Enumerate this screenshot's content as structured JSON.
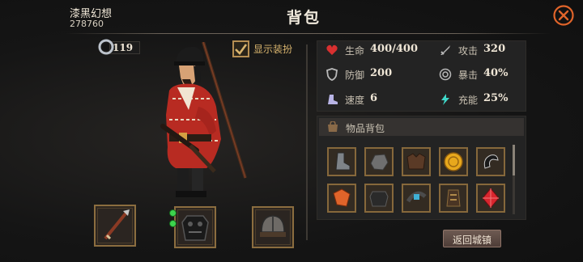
{
  "header": {
    "player_name": "漆黑幻想",
    "player_id": "278760",
    "title": "背包"
  },
  "currency": {
    "icon": "silver-ring-icon",
    "value": "119"
  },
  "display_toggle": {
    "label": "显示装扮",
    "checked": true
  },
  "equipment": [
    {
      "name": "weapon-slot",
      "icon": "spear-icon"
    },
    {
      "name": "armor-slot",
      "icon": "black-armor-icon",
      "indicator": "green-dots"
    },
    {
      "name": "helmet-slot",
      "icon": "helmet-icon"
    }
  ],
  "stats": {
    "hp_label": "生命",
    "hp_value": "400/400",
    "attack_label": "攻击",
    "attack_value": "320",
    "defense_label": "防御",
    "defense_value": "200",
    "crit_label": "暴击",
    "crit_value": "40%",
    "speed_label": "速度",
    "speed_value": "6",
    "charge_label": "充能",
    "charge_value": "25%"
  },
  "inventory": {
    "title": "物品背包",
    "items": [
      "iron-boot-icon",
      "stone-icon",
      "leather-armor-icon",
      "gold-coin-icon",
      "black-hook-icon",
      "orange-cloth-icon",
      "dark-plate-icon",
      "blue-buckle-icon",
      "bronze-chain-icon",
      "red-gem-icon"
    ]
  },
  "return_button": "返回城镇",
  "colors": {
    "frame_gold": "#8b6d3f",
    "accent_orange": "#e0642a",
    "text_gold": "#d8b46e"
  }
}
